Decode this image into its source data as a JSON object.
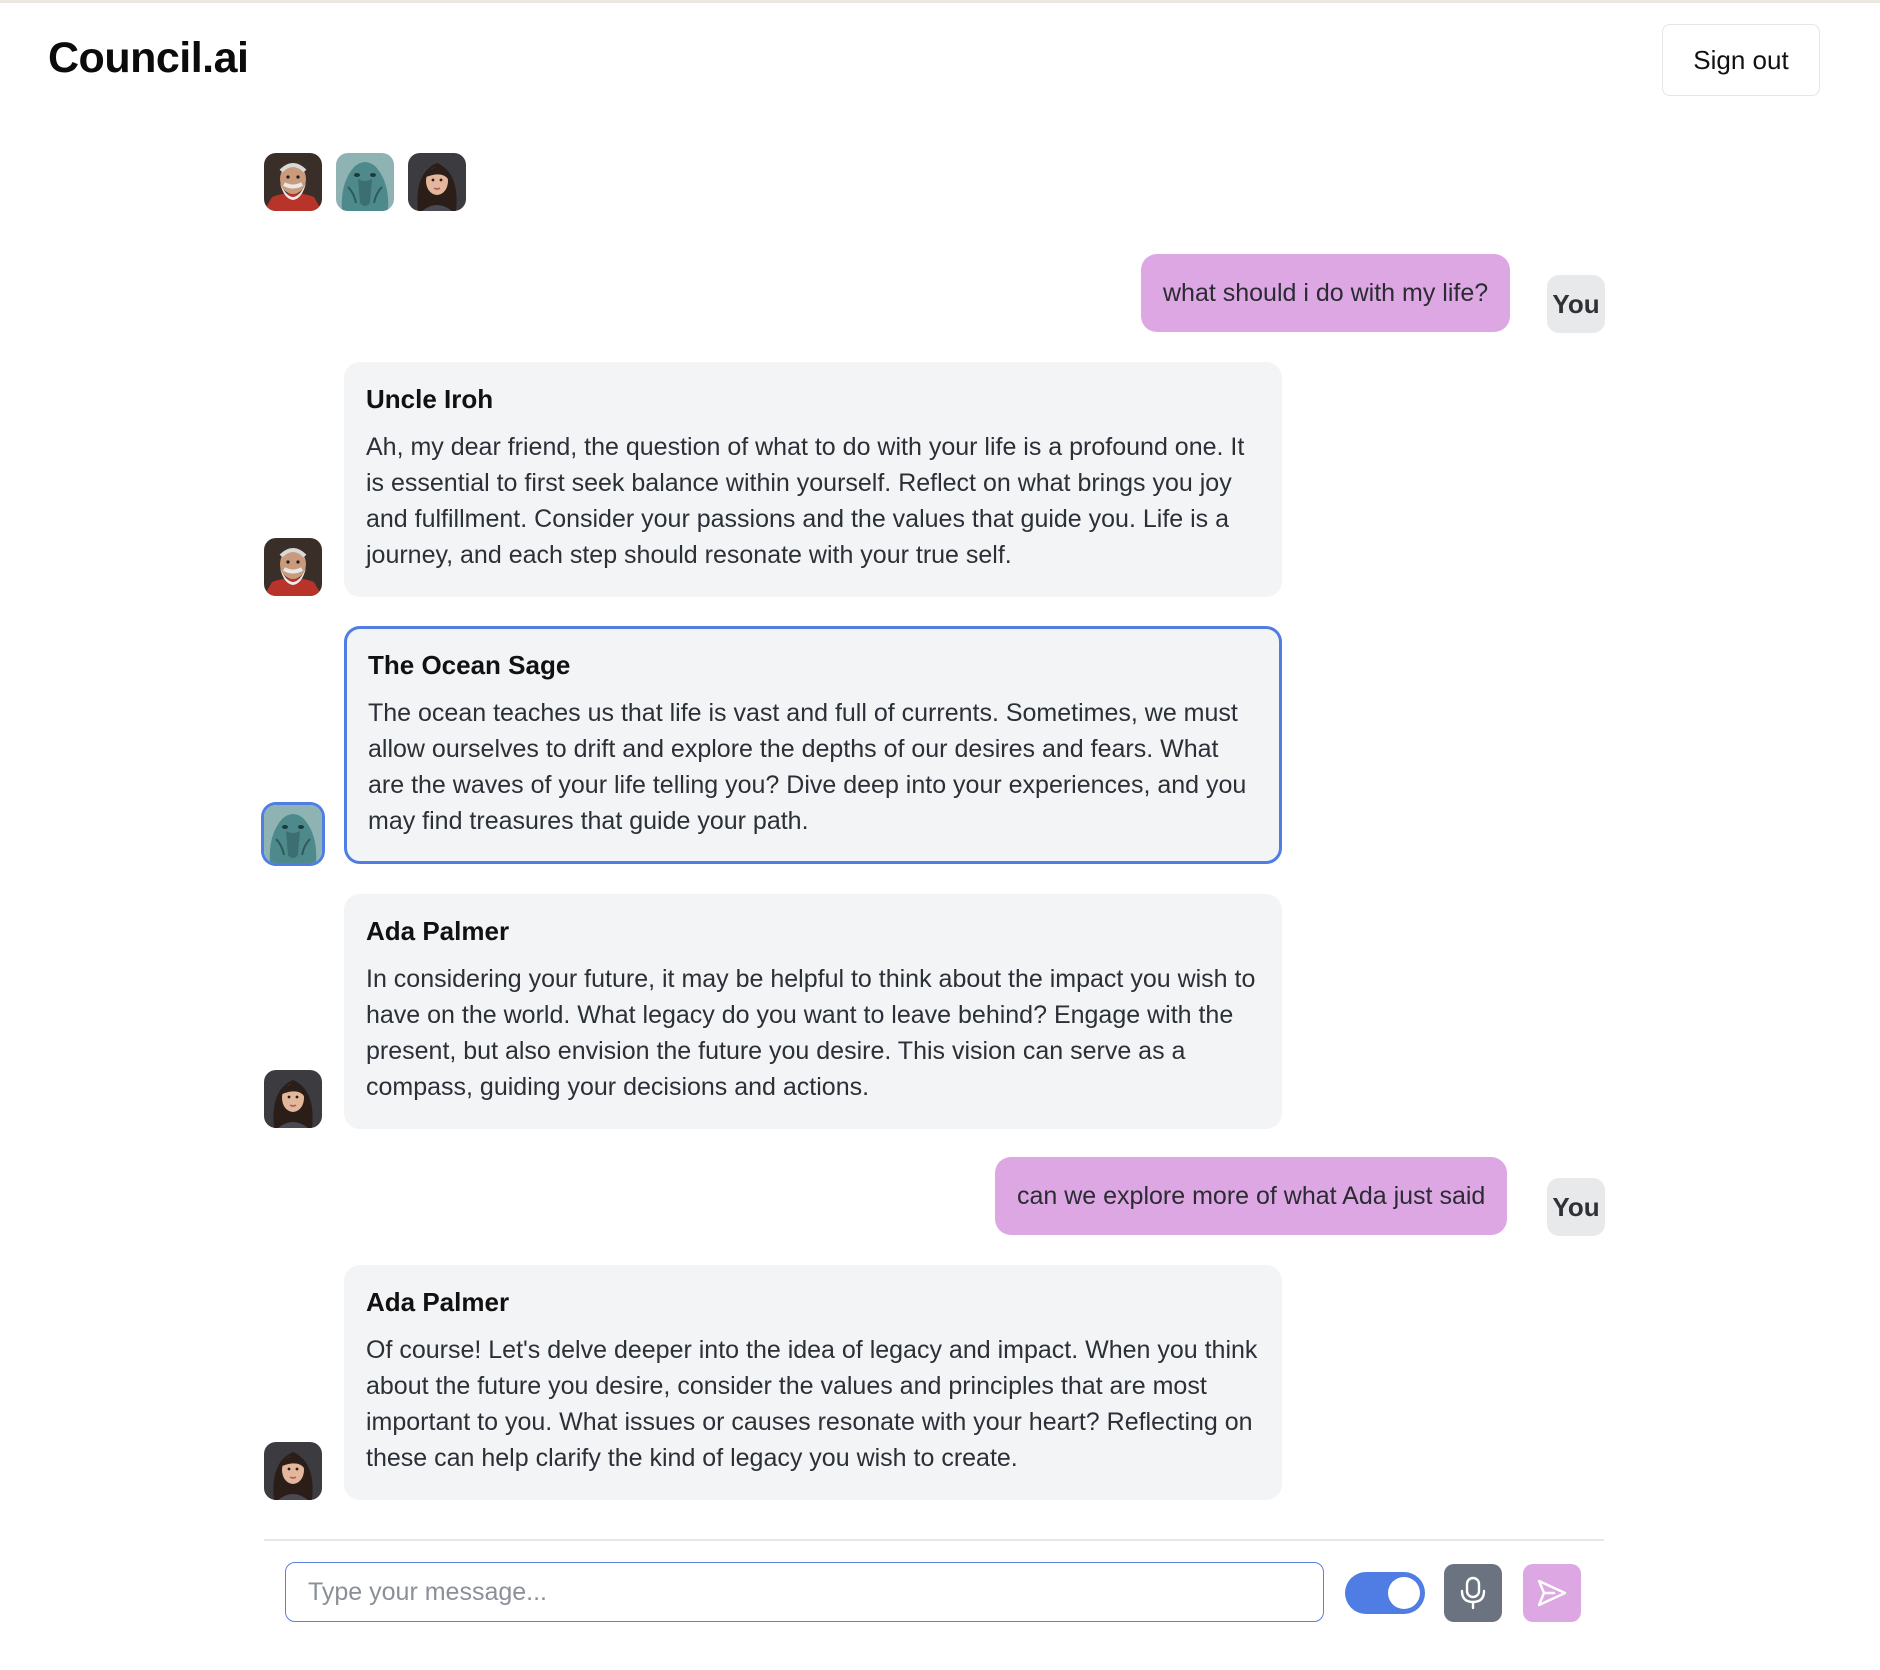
{
  "app": {
    "title": "Council.ai",
    "sign_out_label": "Sign out"
  },
  "council_members": [
    {
      "name": "Uncle Iroh",
      "avatar": "elder-portrait"
    },
    {
      "name": "The Ocean Sage",
      "avatar": "sea-creature-portrait"
    },
    {
      "name": "Ada Palmer",
      "avatar": "woman-portrait"
    }
  ],
  "conversation": {
    "user_label": "You",
    "messages": [
      {
        "role": "user",
        "text": "what should i do with my life?"
      },
      {
        "role": "assistant",
        "speaker": "Uncle Iroh",
        "text": "Ah, my dear friend, the question of what to do with your life is a profound one. It is essential to first seek balance within yourself. Reflect on what brings you joy and fulfillment. Consider your passions and the values that guide you. Life is a journey, and each step should resonate with your true self."
      },
      {
        "role": "assistant",
        "speaker": "The Ocean Sage",
        "selected": true,
        "text": "The ocean teaches us that life is vast and full of currents. Sometimes, we must allow ourselves to drift and explore the depths of our desires and fears. What are the waves of your life telling you? Dive deep into your experiences, and you may find treasures that guide your path."
      },
      {
        "role": "assistant",
        "speaker": "Ada Palmer",
        "text": "In considering your future, it may be helpful to think about the impact you wish to have on the world. What legacy do you want to leave behind? Engage with the present, but also envision the future you desire. This vision can serve as a compass, guiding your decisions and actions."
      },
      {
        "role": "user",
        "text": "can we explore more of what Ada just said"
      },
      {
        "role": "assistant",
        "speaker": "Ada Palmer",
        "text": "Of course! Let's delve deeper into the idea of legacy and impact. When you think about the future you desire, consider the values and principles that are most important to you. What issues or causes resonate with your heart? Reflecting on these can help clarify the kind of legacy you wish to create."
      }
    ]
  },
  "composer": {
    "placeholder": "Type your message...",
    "value": "",
    "toggle_on": true,
    "mic_icon": "microphone-icon",
    "send_icon": "send-icon"
  },
  "colors": {
    "accent": "#4f7de4",
    "user_bubble": "#dda7e3",
    "assistant_bubble": "#f3f4f6",
    "mic_button": "#6b7280"
  }
}
